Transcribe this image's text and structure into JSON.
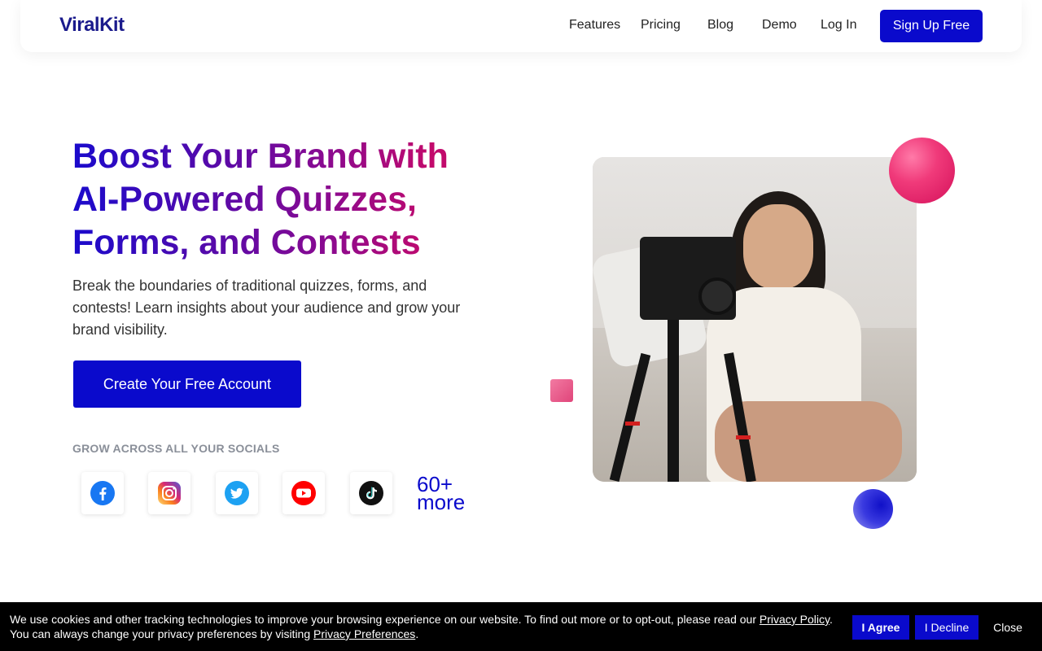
{
  "nav": {
    "logo": "ViralKit",
    "links": [
      "Features",
      "Pricing",
      "Blog",
      "Demo",
      "Log In"
    ],
    "signup": "Sign Up Free"
  },
  "hero": {
    "headline": "Boost Your Brand with AI-Powered Quizzes, Forms, and Contests",
    "subtext": "Break the boundaries of traditional quizzes, forms, and contests! Learn insights about your audience and grow your brand visibility.",
    "cta": "Create Your Free Account",
    "grow_label": "GROW ACROSS ALL YOUR SOCIALS",
    "socials": [
      "facebook-icon",
      "instagram-icon",
      "twitter-icon",
      "youtube-icon",
      "tiktok-icon"
    ],
    "more_count": "60+",
    "more_label": "more"
  },
  "colors": {
    "primary": "#0a0acc",
    "accent_pink": "#e0457a"
  },
  "cookie": {
    "line1": "We use cookies and other tracking technologies to improve your browsing experience on our website. To find out more or to opt-out, please read our ",
    "privacy_policy": "Privacy Policy",
    "line1_end": ".",
    "line2": "You can always change your privacy preferences by visiting ",
    "privacy_prefs": "Privacy Preferences",
    "line2_end": ".",
    "agree": "I Agree",
    "decline": "I Decline",
    "close": "Close"
  }
}
